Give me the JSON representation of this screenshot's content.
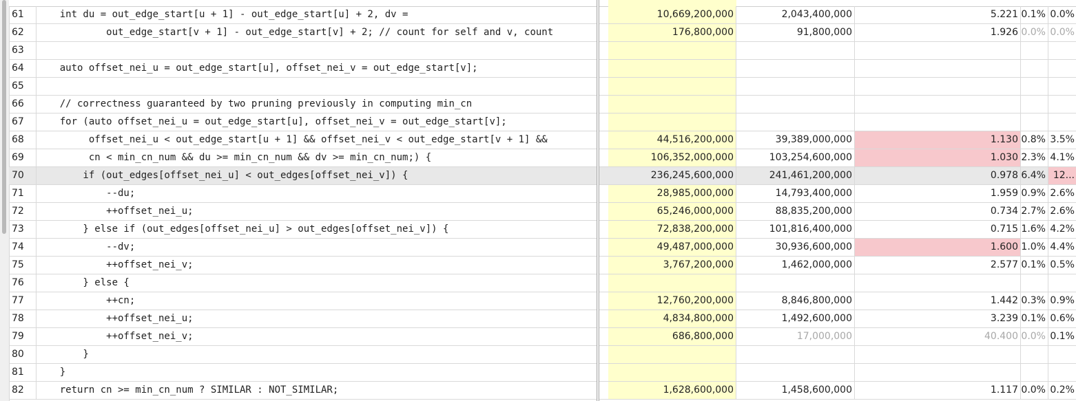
{
  "colors": {
    "highlight_column": "#ffffcc",
    "hot_cell": "#f7c8cc",
    "selected_row": "#e8e8e8",
    "muted_text": "#a8a8a8"
  },
  "rows": [
    {
      "line": "61",
      "code": "    int du = out_edge_start[u + 1] - out_edge_start[u] + 2, dv =",
      "a": "10,669,200,000",
      "b": "2,043,400,000",
      "r": "5.221",
      "p1": "0.1%",
      "p2": "0.0%",
      "hot_r": false,
      "hot_p2": false,
      "muted": [],
      "selected": false
    },
    {
      "line": "62",
      "code": "            out_edge_start[v + 1] - out_edge_start[v] + 2; // count for self and v, count",
      "a": "176,800,000",
      "b": "91,800,000",
      "r": "1.926",
      "p1": "0.0%",
      "p2": "0.0%",
      "hot_r": false,
      "hot_p2": false,
      "muted": [
        "p1",
        "p2"
      ],
      "selected": false
    },
    {
      "line": "63",
      "code": "",
      "a": "",
      "b": "",
      "r": "",
      "p1": "",
      "p2": "",
      "hot_r": false,
      "hot_p2": false,
      "muted": [],
      "selected": false
    },
    {
      "line": "64",
      "code": "    auto offset_nei_u = out_edge_start[u], offset_nei_v = out_edge_start[v];",
      "a": "",
      "b": "",
      "r": "",
      "p1": "",
      "p2": "",
      "hot_r": false,
      "hot_p2": false,
      "muted": [],
      "selected": false
    },
    {
      "line": "65",
      "code": "",
      "a": "",
      "b": "",
      "r": "",
      "p1": "",
      "p2": "",
      "hot_r": false,
      "hot_p2": false,
      "muted": [],
      "selected": false
    },
    {
      "line": "66",
      "code": "    // correctness guaranteed by two pruning previously in computing min_cn",
      "a": "",
      "b": "",
      "r": "",
      "p1": "",
      "p2": "",
      "hot_r": false,
      "hot_p2": false,
      "muted": [],
      "selected": false
    },
    {
      "line": "67",
      "code": "    for (auto offset_nei_u = out_edge_start[u], offset_nei_v = out_edge_start[v];",
      "a": "",
      "b": "",
      "r": "",
      "p1": "",
      "p2": "",
      "hot_r": false,
      "hot_p2": false,
      "muted": [],
      "selected": false
    },
    {
      "line": "68",
      "code": "         offset_nei_u < out_edge_start[u + 1] && offset_nei_v < out_edge_start[v + 1] &&",
      "a": "44,516,200,000",
      "b": "39,389,000,000",
      "r": "1.130",
      "p1": "0.8%",
      "p2": "3.5%",
      "hot_r": true,
      "hot_p2": false,
      "muted": [],
      "selected": false
    },
    {
      "line": "69",
      "code": "         cn < min_cn_num && du >= min_cn_num && dv >= min_cn_num;) {",
      "a": "106,352,000,000",
      "b": "103,254,600,000",
      "r": "1.030",
      "p1": "2.3%",
      "p2": "4.1%",
      "hot_r": true,
      "hot_p2": false,
      "muted": [],
      "selected": false
    },
    {
      "line": "70",
      "code": "        if (out_edges[offset_nei_u] < out_edges[offset_nei_v]) {",
      "a": "236,245,600,000",
      "b": "241,461,200,000",
      "r": "0.978",
      "p1": "6.4%",
      "p2": "12...",
      "hot_r": false,
      "hot_p2": true,
      "muted": [],
      "selected": true
    },
    {
      "line": "71",
      "code": "            --du;",
      "a": "28,985,000,000",
      "b": "14,793,400,000",
      "r": "1.959",
      "p1": "0.9%",
      "p2": "2.6%",
      "hot_r": false,
      "hot_p2": false,
      "muted": [],
      "selected": false
    },
    {
      "line": "72",
      "code": "            ++offset_nei_u;",
      "a": "65,246,000,000",
      "b": "88,835,200,000",
      "r": "0.734",
      "p1": "2.7%",
      "p2": "2.6%",
      "hot_r": false,
      "hot_p2": false,
      "muted": [],
      "selected": false
    },
    {
      "line": "73",
      "code": "        } else if (out_edges[offset_nei_u] > out_edges[offset_nei_v]) {",
      "a": "72,838,200,000",
      "b": "101,816,400,000",
      "r": "0.715",
      "p1": "1.6%",
      "p2": "4.2%",
      "hot_r": false,
      "hot_p2": false,
      "muted": [],
      "selected": false
    },
    {
      "line": "74",
      "code": "            --dv;",
      "a": "49,487,000,000",
      "b": "30,936,600,000",
      "r": "1.600",
      "p1": "1.0%",
      "p2": "4.4%",
      "hot_r": true,
      "hot_p2": false,
      "muted": [],
      "selected": false
    },
    {
      "line": "75",
      "code": "            ++offset_nei_v;",
      "a": "3,767,200,000",
      "b": "1,462,000,000",
      "r": "2.577",
      "p1": "0.1%",
      "p2": "0.5%",
      "hot_r": false,
      "hot_p2": false,
      "muted": [],
      "selected": false
    },
    {
      "line": "76",
      "code": "        } else {",
      "a": "",
      "b": "",
      "r": "",
      "p1": "",
      "p2": "",
      "hot_r": false,
      "hot_p2": false,
      "muted": [],
      "selected": false
    },
    {
      "line": "77",
      "code": "            ++cn;",
      "a": "12,760,200,000",
      "b": "8,846,800,000",
      "r": "1.442",
      "p1": "0.3%",
      "p2": "0.9%",
      "hot_r": false,
      "hot_p2": false,
      "muted": [],
      "selected": false
    },
    {
      "line": "78",
      "code": "            ++offset_nei_u;",
      "a": "4,834,800,000",
      "b": "1,492,600,000",
      "r": "3.239",
      "p1": "0.1%",
      "p2": "0.6%",
      "hot_r": false,
      "hot_p2": false,
      "muted": [],
      "selected": false
    },
    {
      "line": "79",
      "code": "            ++offset_nei_v;",
      "a": "686,800,000",
      "b": "17,000,000",
      "r": "40.400",
      "p1": "0.0%",
      "p2": "0.1%",
      "hot_r": false,
      "hot_p2": false,
      "muted": [
        "b",
        "r",
        "p1"
      ],
      "selected": false
    },
    {
      "line": "80",
      "code": "        }",
      "a": "",
      "b": "",
      "r": "",
      "p1": "",
      "p2": "",
      "hot_r": false,
      "hot_p2": false,
      "muted": [],
      "selected": false
    },
    {
      "line": "81",
      "code": "    }",
      "a": "",
      "b": "",
      "r": "",
      "p1": "",
      "p2": "",
      "hot_r": false,
      "hot_p2": false,
      "muted": [],
      "selected": false
    },
    {
      "line": "82",
      "code": "    return cn >= min_cn_num ? SIMILAR : NOT_SIMILAR;",
      "a": "1,628,600,000",
      "b": "1,458,600,000",
      "r": "1.117",
      "p1": "0.0%",
      "p2": "0.2%",
      "hot_r": false,
      "hot_p2": false,
      "muted": [],
      "selected": false
    }
  ]
}
